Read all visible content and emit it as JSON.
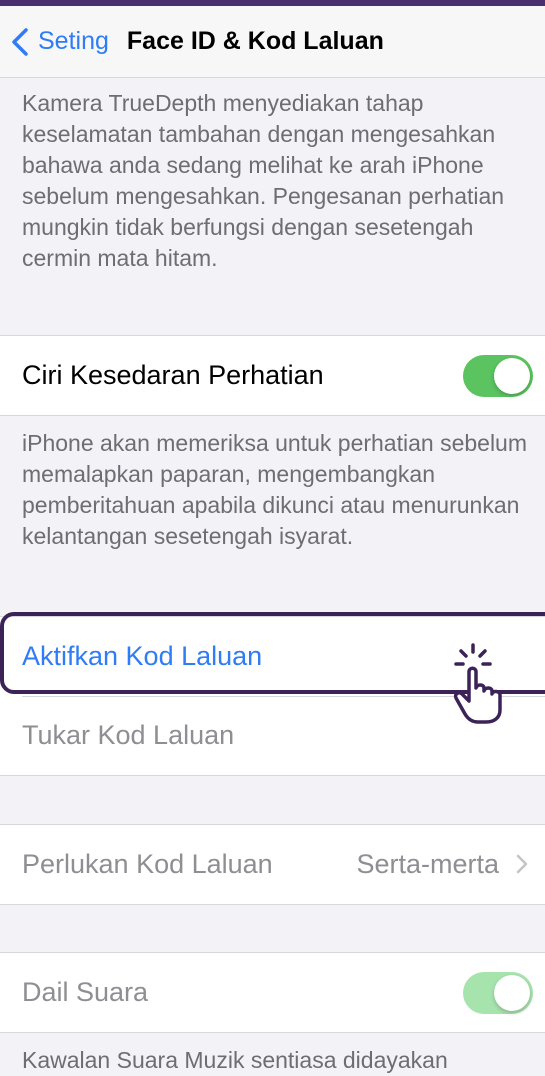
{
  "nav": {
    "back_label": "Seting",
    "title": "Face ID & Kod Laluan"
  },
  "truedepth_footer": "Kamera TrueDepth menyediakan tahap keselamatan tambahan dengan mengesahkan bahawa anda sedang melihat ke arah iPhone sebelum mengesahkan. Pengesanan perhatian mungkin tidak berfungsi dengan sesetengah cermin mata hitam.",
  "attention_row": {
    "label": "Ciri Kesedaran Perhatian",
    "toggle_on": true
  },
  "attention_footer": "iPhone akan memeriksa untuk perhatian sebelum memalapkan paparan, mengembangkan pemberitahuan apabila dikunci atau menurunkan kelantangan sesetengah isyarat.",
  "passcode_group": {
    "turn_on_label": "Aktifkan Kod Laluan",
    "change_label": "Tukar Kod Laluan"
  },
  "require_row": {
    "label": "Perlukan Kod Laluan",
    "value": "Serta-merta"
  },
  "voice_dial_row": {
    "label": "Dail Suara",
    "toggle_on": true
  },
  "voice_dial_footer": "Kawalan Suara Muzik sentiasa didayakan",
  "colors": {
    "accent": "#2f7cf6",
    "toggle_on": "#5bc35f",
    "toggle_disabled": "#a7e3ad",
    "highlight_border": "#3c2357"
  },
  "icons": [
    "chevron-left-icon",
    "chevron-right-icon",
    "pointing-hand-icon"
  ]
}
